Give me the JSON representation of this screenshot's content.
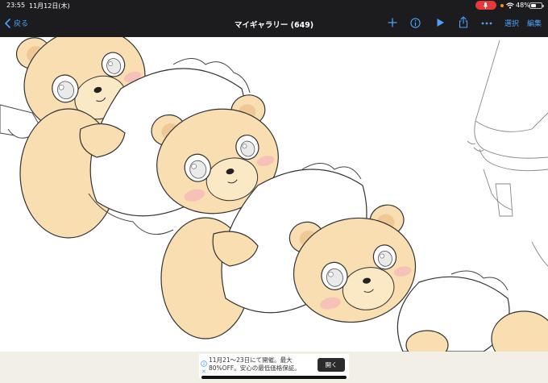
{
  "status_bar": {
    "time": "23:55",
    "date": "11月12日(木)",
    "battery_percent": "48%",
    "battery_level": 0.48
  },
  "nav": {
    "back_label": "戻る",
    "title": "マイギャラリー (649)",
    "select_label": "選択",
    "edit_label": "編集",
    "icons": [
      "chevron-left-icon",
      "plus-icon",
      "info-icon",
      "play-icon",
      "share-icon",
      "ellipsis-icon"
    ]
  },
  "ad": {
    "line1": "11月21〜23日にて開催。最大",
    "line2": "80%OFF。安心の最低価格保証。",
    "button_label": "開く",
    "close_symbol": "✕"
  },
  "colors": {
    "bars": "#1c1c1e",
    "accent": "#4aa3ff",
    "bear_fur": "#f8deb0",
    "cheek": "#f6b8bc",
    "ad_background": "#f2efe6"
  }
}
